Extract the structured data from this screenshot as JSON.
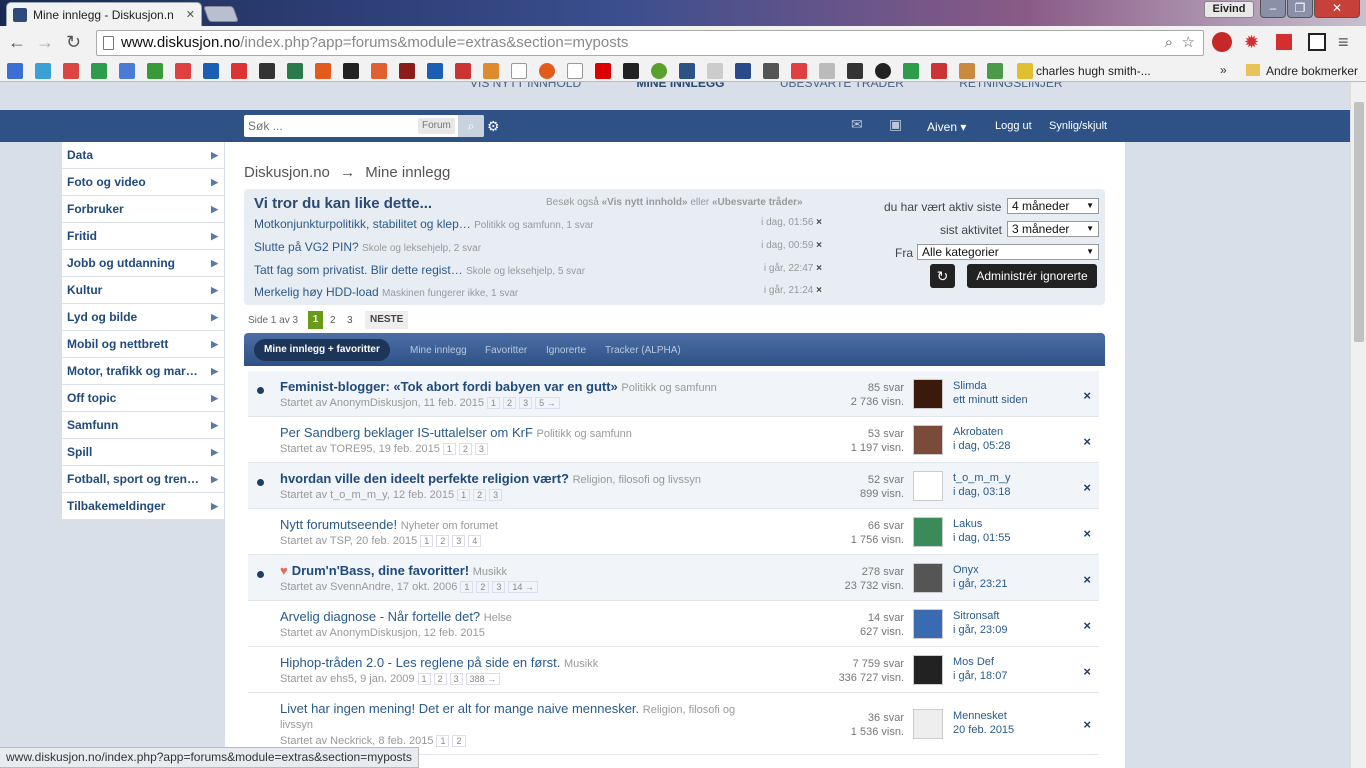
{
  "browser": {
    "tab_title": "Mine innlegg - Diskusjon.n",
    "user": "Eivind",
    "url_host": "www.diskusjon.no",
    "url_path": "/index.php?app=forums&module=extras&section=myposts",
    "bookmark_item": "charles hugh smith-...",
    "other_bookmarks": "Andre bokmerker",
    "status_url": "www.diskusjon.no/index.php?app=forums&module=extras&section=myposts"
  },
  "top_links": [
    "VIS NYTT INNHOLD",
    "MINE INNLEGG",
    "UBESVARTE TRÅDER",
    "RETNINGSLINJER"
  ],
  "nav": {
    "search_placeholder": "Søk ...",
    "search_scope": "Forum",
    "user": "Aiven",
    "logout": "Logg ut",
    "visibility": "Synlig/skjult"
  },
  "sidebar": [
    "Data",
    "Foto og video",
    "Forbruker",
    "Fritid",
    "Jobb og utdanning",
    "Kultur",
    "Lyd og bilde",
    "Mobil og nettbrett",
    "Motor, trafikk og mar…",
    "Off topic",
    "Samfunn",
    "Spill",
    "Fotball, sport og tren…",
    "Tilbakemeldinger"
  ],
  "breadcrumb": {
    "root": "Diskusjon.no",
    "arrow": "→",
    "current": "Mine innlegg"
  },
  "suggest": {
    "heading": "Vi tror du kan like dette...",
    "visit_prefix": "Besøk også",
    "visit_link1": "«Vis nytt innhold»",
    "visit_or": "eller",
    "visit_link2": "«Ubesvarte tråder»",
    "items": [
      {
        "title": "Motkonjunkturpolitikk, stabilitet og klep…",
        "meta": "Politikk og samfunn, 1 svar",
        "when": "i dag, 01:56"
      },
      {
        "title": "Slutte på VG2 PIN?",
        "meta": "Skole og leksehjelp, 2 svar",
        "when": "i dag, 00:59"
      },
      {
        "title": "Tatt fag som privatist. Blir dette regist…",
        "meta": "Skole og leksehjelp, 5 svar",
        "when": "i går, 22:47"
      },
      {
        "title": "Merkelig høy HDD-load",
        "meta": "Maskinen fungerer ikke, 1 svar",
        "when": "i går, 21:24"
      }
    ]
  },
  "filters": {
    "active_label": "du har vært aktiv siste",
    "active_value": "4 måneder",
    "activity_label": "sist aktivitet",
    "activity_value": "3 måneder",
    "from_label": "Fra",
    "from_value": "Alle kategorier",
    "manage_ignored": "Administrér ignorerte",
    "refresh_icon": "↻"
  },
  "pager": {
    "label": "Side 1 av 3",
    "pages": [
      "1",
      "2",
      "3"
    ],
    "next": "NESTE"
  },
  "tabs": {
    "active": "Mine innlegg + favoritter",
    "others": [
      "Mine innlegg",
      "Favoritter",
      "Ignorerte",
      "Tracker (ALPHA)"
    ]
  },
  "threads": [
    {
      "title": "Feminist-blogger: «Tok abort fordi babyen var en gutt»",
      "cat": "Politikk og samfunn",
      "started": "Startet av AnonymDiskusjon, 11 feb. 2015",
      "pages": [
        "1",
        "2",
        "3",
        "5 →"
      ],
      "replies": "85 svar",
      "views": "2 736 visn.",
      "user": "Slimda",
      "time": "ett minutt siden",
      "unread": true
    },
    {
      "title": "Per Sandberg beklager IS-uttalelser om KrF",
      "cat": "Politikk og samfunn",
      "started": "Startet av TORE95, 19 feb. 2015",
      "pages": [
        "1",
        "2",
        "3"
      ],
      "replies": "53 svar",
      "views": "1 197 visn.",
      "user": "Akrobaten",
      "time": "i dag, 05:28",
      "unread": false
    },
    {
      "title": "hvordan ville den ideelt perfekte religion vært?",
      "cat": "Religion, filosofi og livssyn",
      "started": "Startet av t_o_m_m_y, 12 feb. 2015",
      "pages": [
        "1",
        "2",
        "3"
      ],
      "replies": "52 svar",
      "views": "899 visn.",
      "user": "t_o_m_m_y",
      "time": "i dag, 03:18",
      "unread": true
    },
    {
      "title": "Nytt forumutseende!",
      "cat": "Nyheter om forumet",
      "started": "Startet av TSP, 20 feb. 2015",
      "pages": [
        "1",
        "2",
        "3",
        "4"
      ],
      "replies": "66 svar",
      "views": "1 756 visn.",
      "user": "Lakus",
      "time": "i dag, 01:55",
      "unread": false
    },
    {
      "title": "Drum'n'Bass, dine favoritter!",
      "cat": "Musikk",
      "started": "Startet av SvennAndre, 17 okt. 2006",
      "pages": [
        "1",
        "2",
        "3",
        "14 →"
      ],
      "replies": "278 svar",
      "views": "23 732 visn.",
      "user": "Onyx",
      "time": "i går, 23:21",
      "unread": true
    },
    {
      "title": "Arvelig diagnose - Når fortelle det?",
      "cat": "Helse",
      "started": "Startet av AnonymDiskusjon, 12 feb. 2015",
      "pages": [],
      "replies": "14 svar",
      "views": "627 visn.",
      "user": "Sitronsaft",
      "time": "i går, 23:09",
      "unread": false
    },
    {
      "title": "Hiphop-tråden 2.0 - Les reglene på side en først.",
      "cat": "Musikk",
      "started": "Startet av ehs5, 9 jan. 2009",
      "pages": [
        "1",
        "2",
        "3",
        "388 →"
      ],
      "replies": "7 759 svar",
      "views": "336 727 visn.",
      "user": "Mos Def",
      "time": "i går, 18:07",
      "unread": false
    },
    {
      "title": "Livet har ingen mening! Det er alt for mange naive mennesker.",
      "cat": "Religion, filosofi og livssyn",
      "started": "Startet av Neckrick, 8 feb. 2015",
      "pages": [
        "1",
        "2"
      ],
      "replies": "36 svar",
      "views": "1 536 visn.",
      "user": "Mennesket",
      "time": "20 feb. 2015",
      "unread": false
    }
  ],
  "remove_icon": "×"
}
